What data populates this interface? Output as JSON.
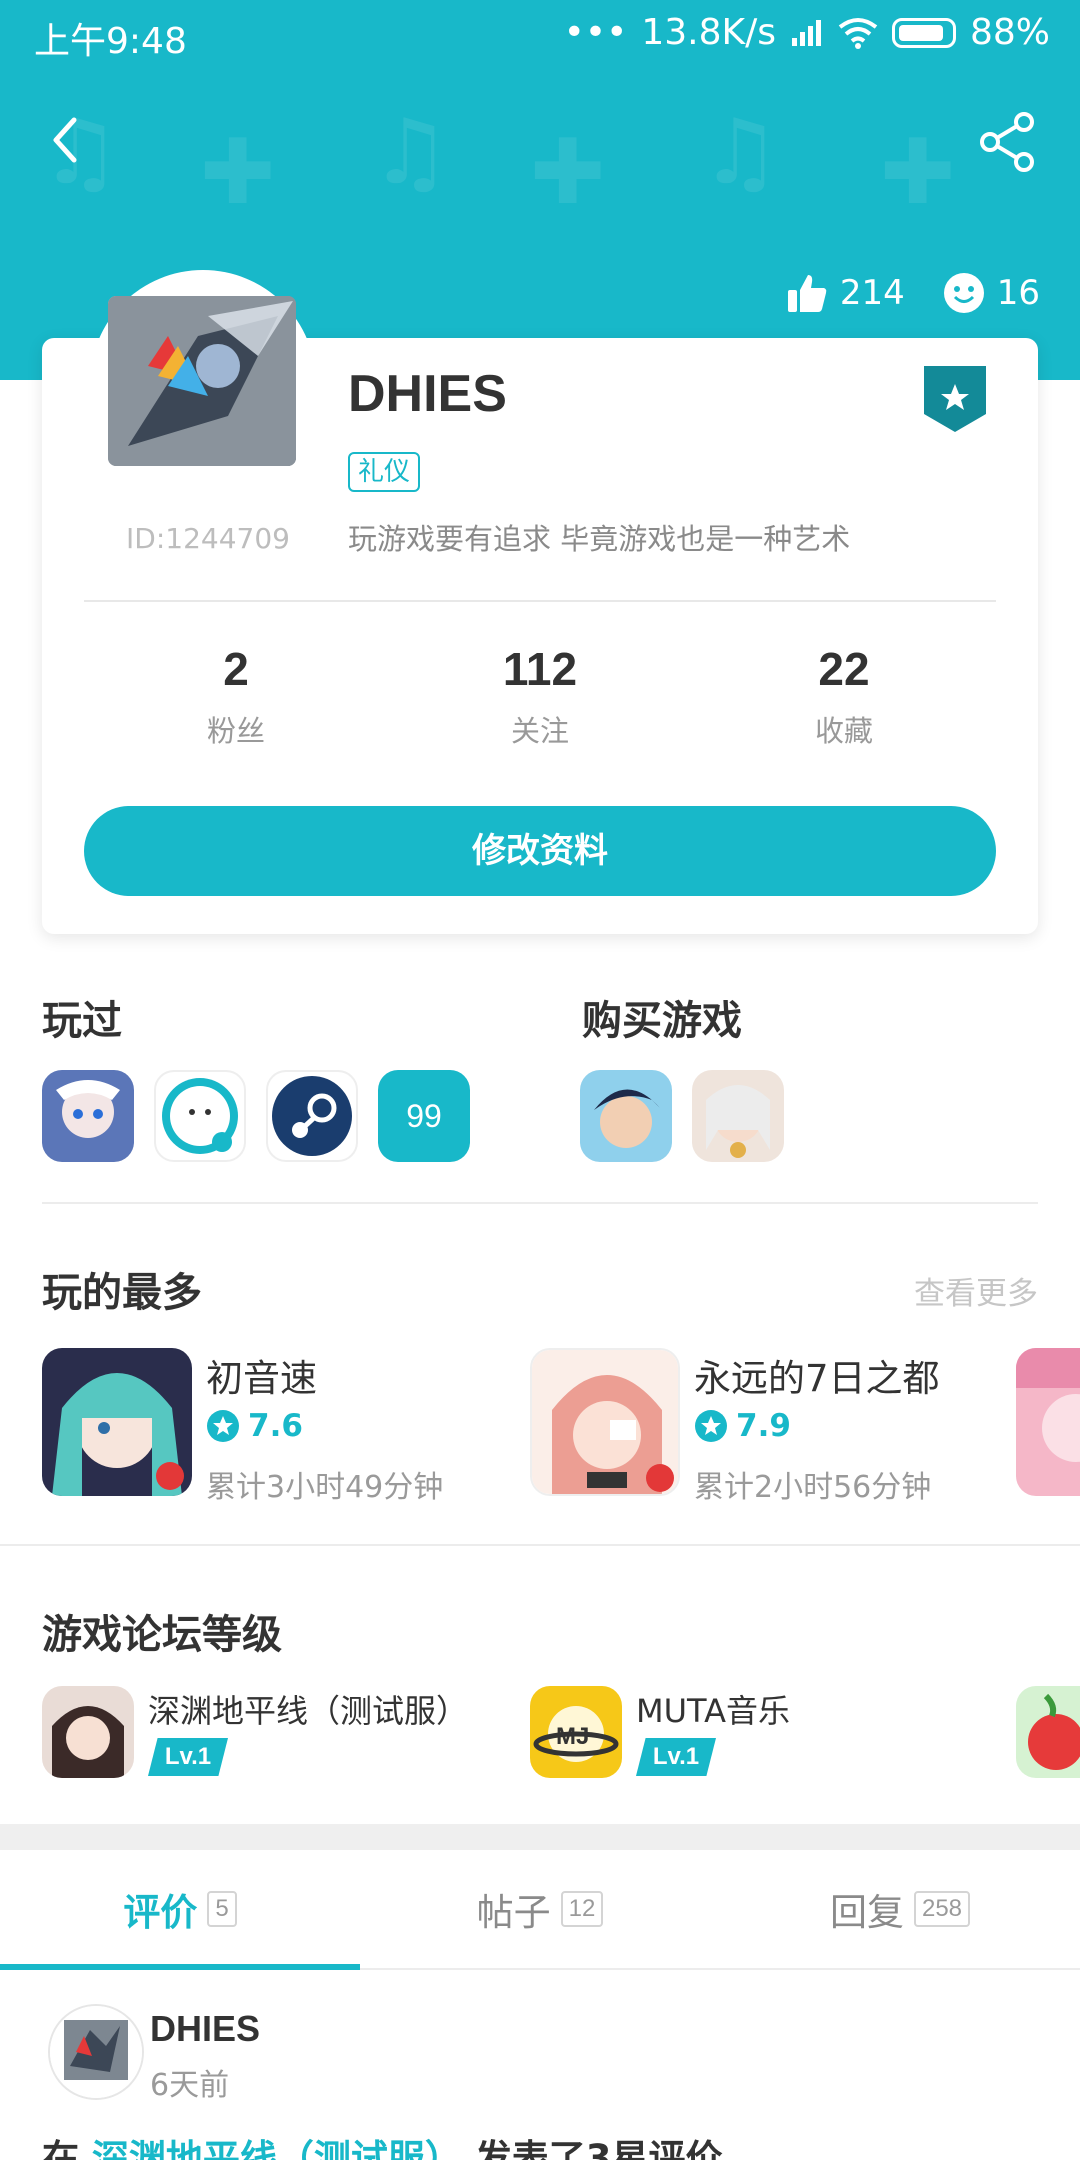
{
  "status_bar": {
    "time": "上午9:48",
    "dots": "•••",
    "network_speed": "13.8K/s",
    "battery": "88%"
  },
  "header": {
    "likes": "214",
    "smiles": "16"
  },
  "profile": {
    "username": "DHIES",
    "tag": "礼仪",
    "user_id": "ID:1244709",
    "bio": "玩游戏要有追求 毕竟游戏也是一种艺术",
    "stats": [
      {
        "value": "2",
        "label": "粉丝"
      },
      {
        "value": "112",
        "label": "关注"
      },
      {
        "value": "22",
        "label": "收藏"
      }
    ],
    "edit_button": "修改资料"
  },
  "played": {
    "title": "玩过",
    "more_count": "99"
  },
  "purchased": {
    "title": "购买游戏"
  },
  "most_played": {
    "title": "玩的最多",
    "more_link": "查看更多",
    "games": [
      {
        "name": "初音速",
        "rating": "7.6",
        "time": "累计3小时49分钟"
      },
      {
        "name": "永远的7日之都",
        "rating": "7.9",
        "time": "累计2小时56分钟"
      }
    ]
  },
  "forum_level": {
    "title": "游戏论坛等级",
    "items": [
      {
        "name": "深渊地平线（测试服）",
        "level": "Lv.1"
      },
      {
        "name": "MUTA音乐",
        "level": "Lv.1"
      }
    ]
  },
  "tabs": [
    {
      "label": "评价",
      "count": "5"
    },
    {
      "label": "帖子",
      "count": "12"
    },
    {
      "label": "回复",
      "count": "258"
    }
  ],
  "post": {
    "username": "DHIES",
    "time": "6天前",
    "prefix": "在",
    "game_link": "深渊地平线（测试服）",
    "suffix": "发表了3星评价"
  },
  "colors": {
    "accent": "#18b8c9",
    "background": "#ffffff"
  },
  "icons": [
    "back-icon",
    "share-icon",
    "thumbs-up-icon",
    "smile-icon",
    "wifi-icon",
    "signal-icon",
    "battery-icon",
    "badge-star-icon",
    "star-icon"
  ]
}
